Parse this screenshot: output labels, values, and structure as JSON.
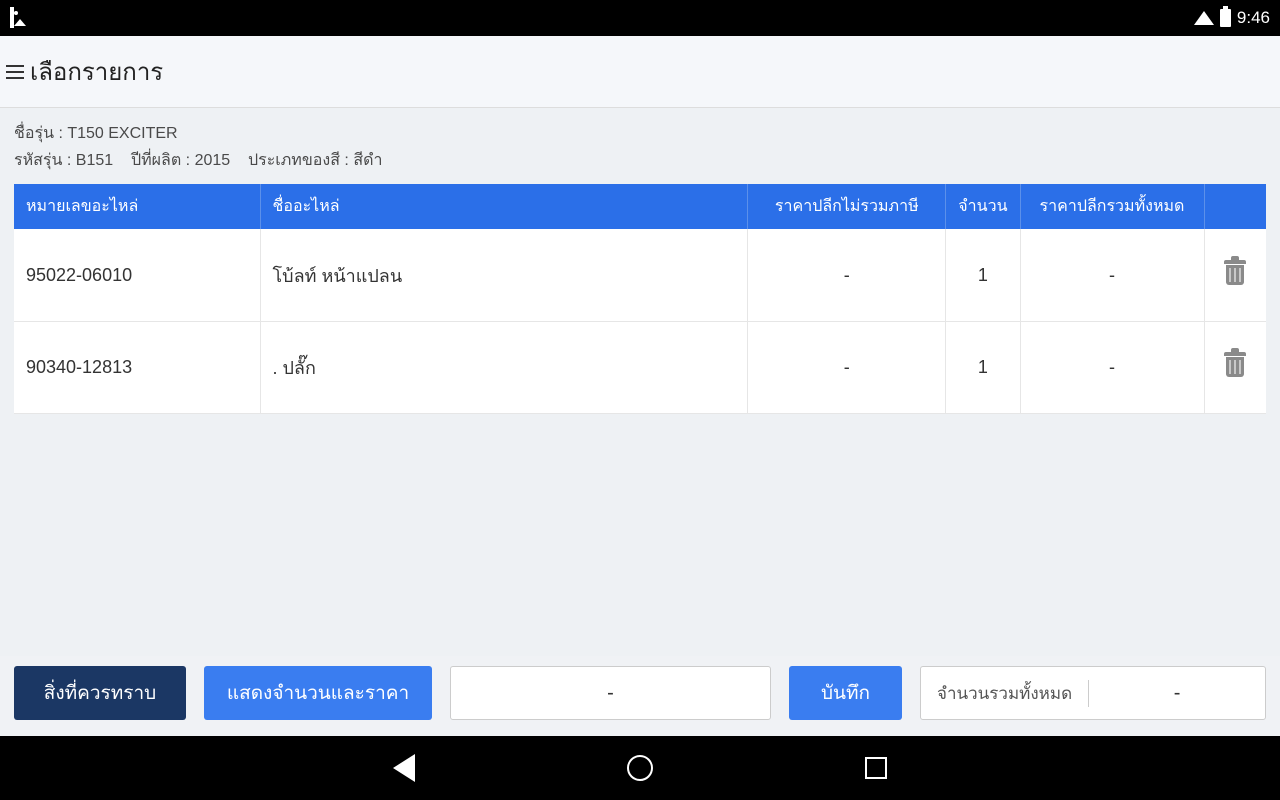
{
  "status": {
    "time": "9:46"
  },
  "app": {
    "title": "เลือกรายการ"
  },
  "model": {
    "name_label": "ชื่อรุ่น :",
    "name": "T150 EXCITER",
    "code_label": "รหัสรุ่น :",
    "code": "B151",
    "year_label": "ปีที่ผลิต :",
    "year": "2015",
    "color_label": "ประเภทของสี :",
    "color": "สีดำ"
  },
  "table": {
    "headers": {
      "part_no": "หมายเลขอะไหล่",
      "part_name": "ชื่ออะไหล่",
      "price_ex": "ราคาปลีกไม่รวมภาษี",
      "qty": "จำนวน",
      "price_total": "ราคาปลีกรวมทั้งหมด"
    },
    "rows": [
      {
        "part_no": "95022-06010",
        "part_name": "โบ้ลท์ หน้าแปลน",
        "price_ex": "-",
        "qty": "1",
        "price_total": "-"
      },
      {
        "part_no": "90340-12813",
        "part_name": ". ปลั๊ก",
        "price_ex": "-",
        "qty": "1",
        "price_total": "-"
      }
    ]
  },
  "buttons": {
    "notice": "สิ่งที่ควรทราบ",
    "show_qty_price": "แสดงจำนวนและราคา",
    "mid_display": "-",
    "save": "บันทึก",
    "total_label": "จำนวนรวมทั้งหมด",
    "total_value": "-"
  }
}
